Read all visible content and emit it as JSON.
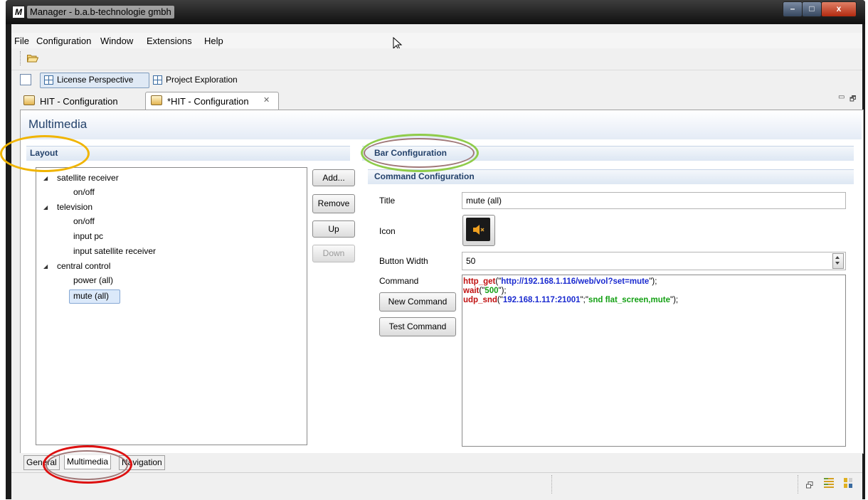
{
  "window": {
    "title": "Manager - b.a.b-technologie gmbh",
    "app_icon_letter": "M",
    "minimize": "–",
    "maximize": "□",
    "close": "x"
  },
  "menubar": {
    "items": [
      "File",
      "Configuration",
      "Window",
      "Extensions",
      "Help"
    ]
  },
  "perspectives": {
    "license": "License Perspective",
    "exploration": "Project Exploration"
  },
  "editor_tabs": [
    {
      "label": "HIT - Configuration",
      "active": false
    },
    {
      "label": "*HIT - Configuration",
      "active": true,
      "close": "✕"
    }
  ],
  "view_controls": {
    "minimize": "▭",
    "maximize": "🗗"
  },
  "editor": {
    "title": "Multimedia",
    "layout": {
      "title": "Layout",
      "tree": [
        {
          "label": "satellite receiver",
          "children": [
            "on/off"
          ]
        },
        {
          "label": "television",
          "children": [
            "on/off",
            "input pc",
            "input satellite receiver"
          ]
        },
        {
          "label": "central control",
          "children": [
            "power (all)",
            "mute (all)"
          ]
        }
      ],
      "selected": "mute (all)"
    },
    "tree_buttons": {
      "add": "Add...",
      "remove": "Remove",
      "up": "Up",
      "down": "Down"
    },
    "bar_configuration": {
      "title": "Bar Configuration"
    },
    "command_configuration": {
      "title": "Command Configuration",
      "title_label": "Title",
      "title_value": "mute (all)",
      "icon_label": "Icon",
      "icon_name": "speaker-mute-icon",
      "button_width_label": "Button Width",
      "button_width_value": "50",
      "command_label": "Command",
      "new_command": "New Command",
      "test_command": "Test Command",
      "command_lines": [
        {
          "fn": "http_get",
          "open": "(\"",
          "arg": "http://192.168.1.116/web/vol?set=mute",
          "close": "\");"
        },
        {
          "fn": "wait",
          "open": "(\"",
          "arg": "500",
          "close": "\");"
        },
        {
          "fn": "udp_snd",
          "open": "(\"",
          "arg": "192.168.1.117:21001",
          "mid": "\";\"",
          "arg2": "snd flat_screen,mute",
          "close": "\");"
        }
      ]
    }
  },
  "bottom_tabs": [
    "General",
    "Multimedia",
    "Navigation"
  ],
  "active_bottom_tab": "Multimedia",
  "annotations": {
    "layout_ellipse": "#f0b400",
    "bar_ellipse_outer": "#8fcc4a",
    "bar_ellipse_inner": "#a07878",
    "tab_ellipse": "#dd1010"
  },
  "colors": {
    "section_title": "#24426b",
    "keyword": "#c01010",
    "string": "#1a2ad0",
    "string_alt": "#14a014"
  }
}
